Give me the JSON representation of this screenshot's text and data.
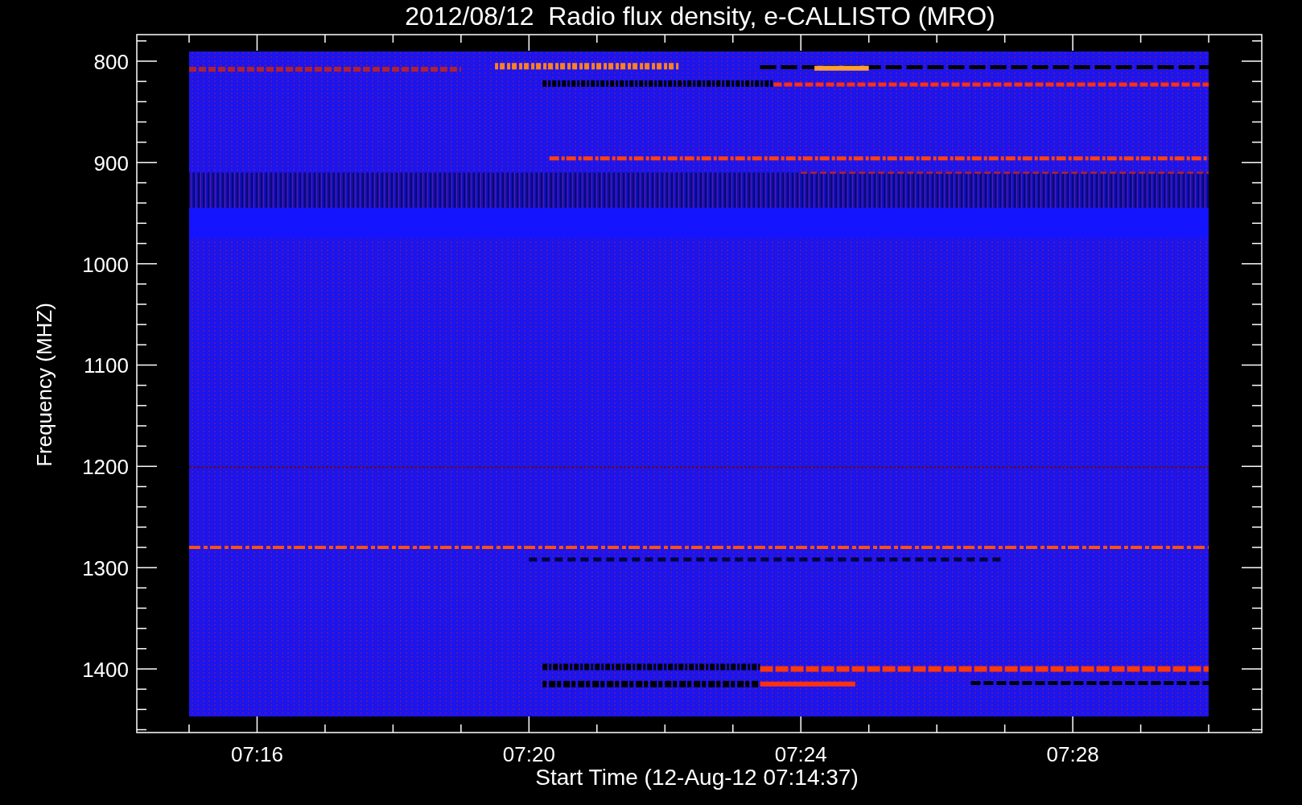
{
  "title": "2012/08/12  Radio flux density, e-CALLISTO (MRO)",
  "y_axis": {
    "label": "Frequency (MHZ)",
    "ticks": [
      "800",
      "900",
      "1000",
      "1100",
      "1200",
      "1300",
      "1400"
    ]
  },
  "x_axis": {
    "label": "Start Time (12-Aug-12 07:14:37)",
    "ticks": [
      "07:16",
      "07:20",
      "07:24",
      "07:28"
    ]
  }
}
